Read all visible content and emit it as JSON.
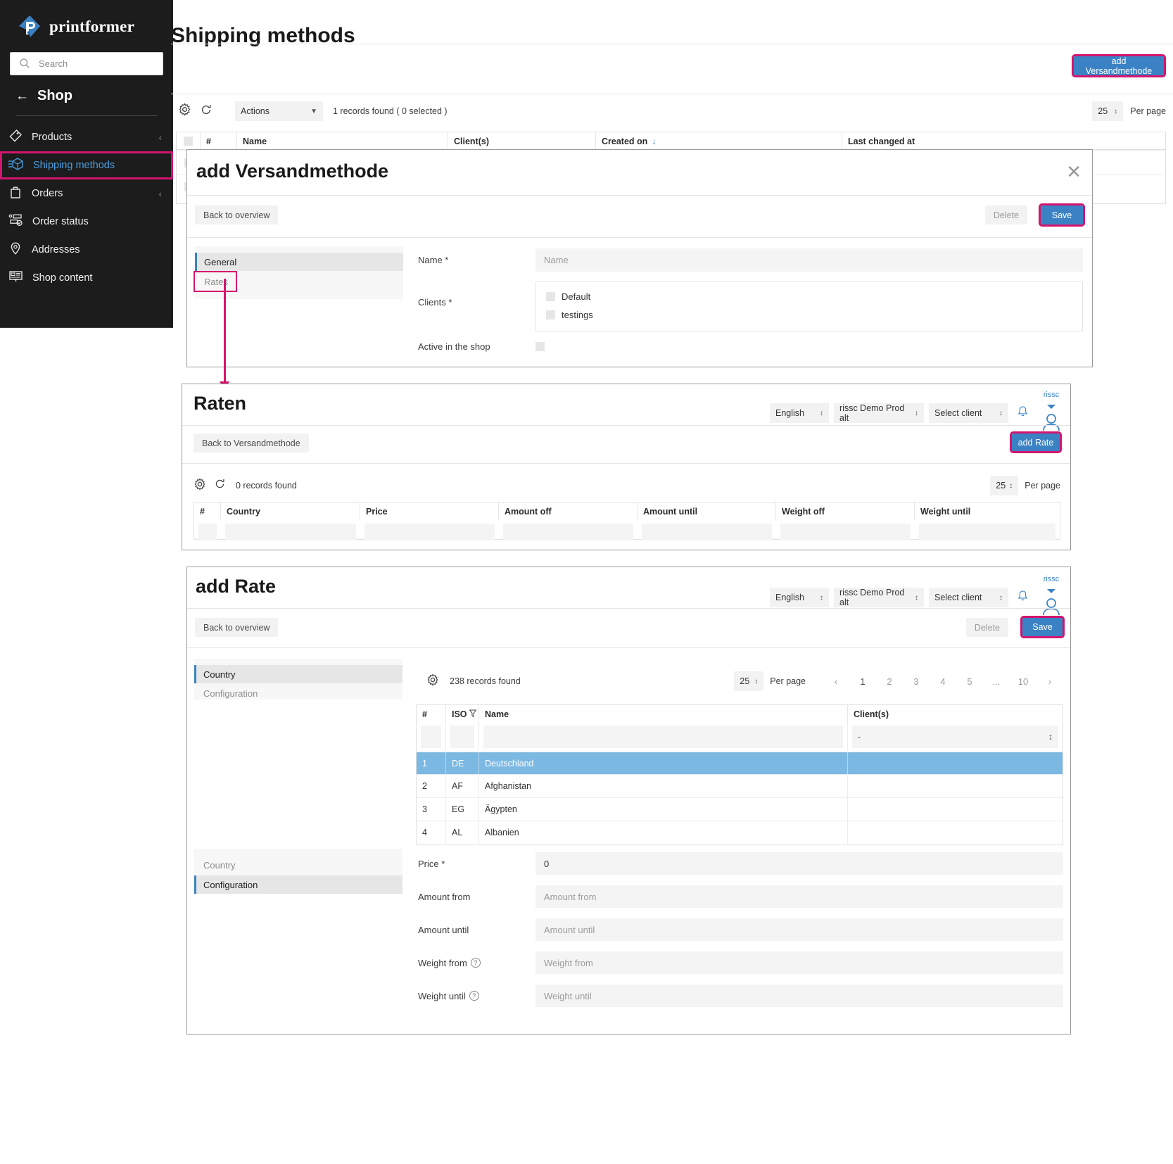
{
  "sidebar": {
    "brand": "printformer",
    "search_placeholder": "Search",
    "back_label": "Shop",
    "items": [
      {
        "label": "Products",
        "icon": "tag-icon",
        "chevron": "‹",
        "active": false
      },
      {
        "label": "Shipping methods",
        "icon": "box-icon",
        "chevron": "",
        "active": true
      },
      {
        "label": "Orders",
        "icon": "bag-icon",
        "chevron": "‹",
        "active": false
      },
      {
        "label": "Order status",
        "icon": "flow-check-icon",
        "chevron": "",
        "active": false
      },
      {
        "label": "Addresses",
        "icon": "pin-icon",
        "chevron": "",
        "active": false
      },
      {
        "label": "Shop content",
        "icon": "layout-icon",
        "chevron": "",
        "active": false
      }
    ]
  },
  "page": {
    "title": "Shipping methods",
    "add_button": "add Versandmethode"
  },
  "overview_toolbar": {
    "actions_label": "Actions",
    "records_found": "1 records found ( 0 selected )",
    "per_page_value": "25",
    "per_page_label": "Per page"
  },
  "overview_table": {
    "columns": [
      "#",
      "Name",
      "Client(s)",
      "Created on",
      "Last changed at"
    ],
    "sort_indicator": "↓"
  },
  "modal_versandmethode": {
    "title": "add Versandmethode",
    "close_icon": "close-icon",
    "back_button": "Back to overview",
    "delete_button": "Delete",
    "save_button": "Save",
    "tabs": [
      {
        "label": "General",
        "active": true,
        "highlighted": false
      },
      {
        "label": "Rates",
        "active": false,
        "highlighted": true
      }
    ],
    "fields": {
      "name_label": "Name *",
      "name_placeholder": "Name",
      "clients_label": "Clients *",
      "clients_options": [
        "Default",
        "testings"
      ],
      "active_label": "Active in the shop"
    }
  },
  "panel_raten": {
    "title": "Raten",
    "language_value": "English",
    "tenant_value": "rissc Demo Prod alt",
    "client_value": "Select client",
    "bell_icon": "bell-icon",
    "user_label": "rissc",
    "user_icon": "user-icon",
    "back_button": "Back to Versandmethode",
    "add_button": "add Rate",
    "records_found": "0 records found",
    "per_page_value": "25",
    "per_page_label": "Per page",
    "columns": [
      "#",
      "Country",
      "Price",
      "Amount off",
      "Amount until",
      "Weight off",
      "Weight until"
    ]
  },
  "panel_add_rate": {
    "title": "add Rate",
    "language_value": "English",
    "tenant_value": "rissc Demo Prod alt",
    "client_value": "Select client",
    "bell_icon": "bell-icon",
    "user_label": "rissc",
    "user_icon": "user-icon",
    "back_button": "Back to overview",
    "delete_button": "Delete",
    "save_button": "Save",
    "tabs_top": [
      {
        "label": "Country",
        "active": true
      },
      {
        "label": "Configuration",
        "active": false
      }
    ],
    "tabs_bottom": [
      {
        "label": "Country",
        "active": false
      },
      {
        "label": "Configuration",
        "active": true
      }
    ],
    "records_found": "238 records found",
    "per_page_value": "25",
    "per_page_label": "Per page",
    "pagination": {
      "prev": "‹",
      "next": "›",
      "pages": [
        "1",
        "2",
        "3",
        "4",
        "5",
        "...",
        "10"
      ],
      "current": "1"
    },
    "country_table": {
      "columns": [
        "#",
        "ISO",
        "Name",
        "Client(s)"
      ],
      "filter_iso_icon": "filter-icon",
      "client_filter_value": "-",
      "rows": [
        {
          "num": "1",
          "iso": "DE",
          "name": "Deutschland",
          "clients": "",
          "selected": true
        },
        {
          "num": "2",
          "iso": "AF",
          "name": "Afghanistan",
          "clients": "",
          "selected": false
        },
        {
          "num": "3",
          "iso": "EG",
          "name": "Ägypten",
          "clients": "",
          "selected": false
        },
        {
          "num": "4",
          "iso": "AL",
          "name": "Albanien",
          "clients": "",
          "selected": false
        }
      ]
    },
    "config_fields": [
      {
        "label": "Price *",
        "value": "0",
        "placeholder": "",
        "help": false
      },
      {
        "label": "Amount from",
        "value": "",
        "placeholder": "Amount from",
        "help": false
      },
      {
        "label": "Amount until",
        "value": "",
        "placeholder": "Amount until",
        "help": false
      },
      {
        "label": "Weight from",
        "value": "",
        "placeholder": "Weight from",
        "help": true
      },
      {
        "label": "Weight until",
        "value": "",
        "placeholder": "Weight until",
        "help": true
      }
    ]
  },
  "colors": {
    "accent_blue": "#3b82c4",
    "highlight_pink": "#d4146e",
    "sidebar_bg": "#1c1c1c",
    "row_selected": "#7cb9e2"
  }
}
